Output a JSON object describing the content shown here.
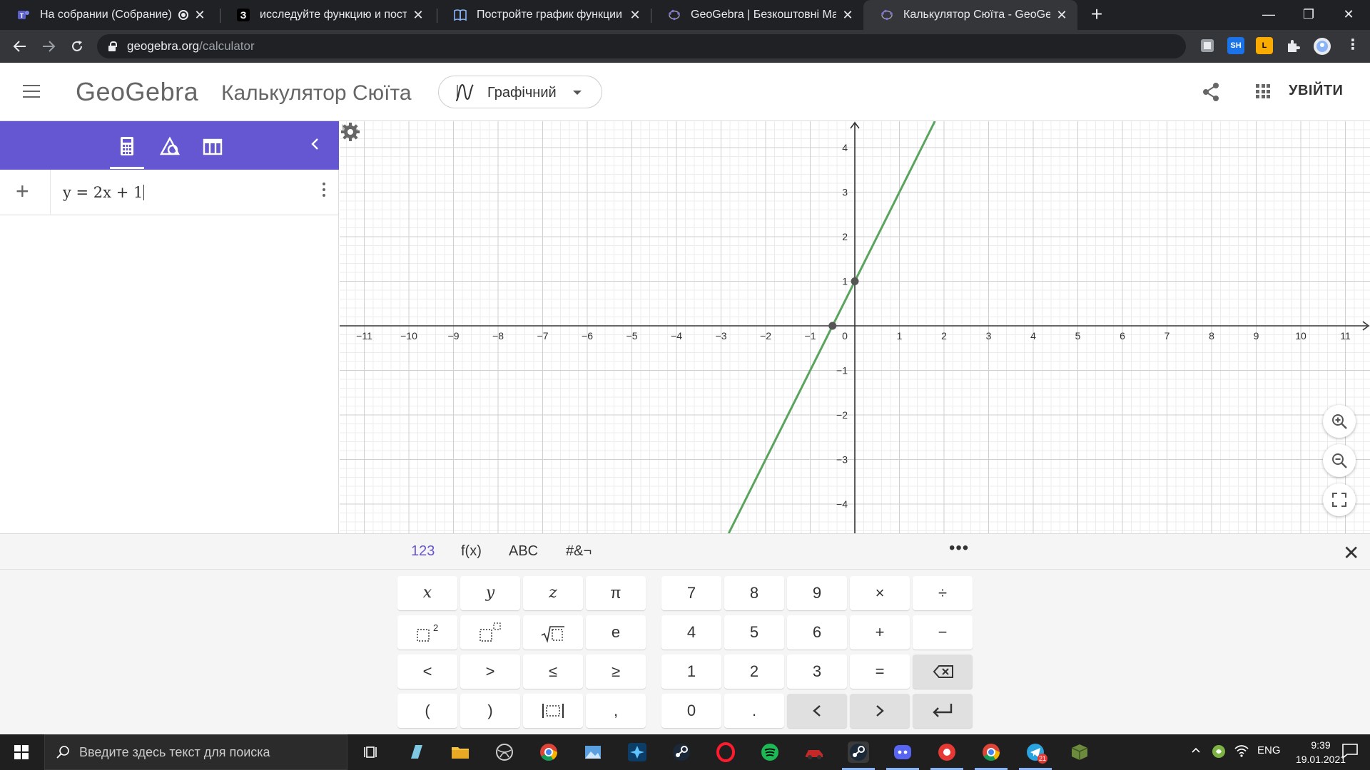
{
  "browser": {
    "tabs": [
      {
        "title": "На собрании (Собрание) | M",
        "icon": "teams-icon"
      },
      {
        "title": "исследуйте функцию и построй",
        "icon": "znanija-icon"
      },
      {
        "title": "Постройте график функции у =",
        "icon": "book-icon"
      },
      {
        "title": "GeoGebra | Безкоштовні Матем",
        "icon": "geogebra-icon"
      },
      {
        "title": "Калькулятор Сюїта - GeoGebra",
        "icon": "geogebra-icon"
      }
    ],
    "new_tab": "+",
    "window_controls": {
      "minimize": "—",
      "restore": "❐",
      "close": "✕"
    },
    "url_host": "geogebra.org",
    "url_path": "/calculator",
    "extensions": [
      {
        "name": "extension-gray",
        "label": "",
        "color": "#9aa0a6"
      },
      {
        "name": "extension-sh",
        "label": "SH",
        "color": "#1a73e8"
      },
      {
        "name": "extension-l",
        "label": "L",
        "color": "#f9ab00"
      }
    ]
  },
  "header": {
    "logo": "GeoGebra",
    "title": "Калькулятор Сюїта",
    "app_switch_label": "Графічний",
    "login": "УВІЙТИ"
  },
  "algebra": {
    "input_expression": "y = 2x + 1"
  },
  "graph": {
    "x_range": [
      -11,
      11
    ],
    "y_range": [
      -4,
      4
    ],
    "x_ticks": [
      "−11",
      "−10",
      "−9",
      "−8",
      "−7",
      "−6",
      "−5",
      "−4",
      "−3",
      "−2",
      "−1",
      "0",
      "1",
      "2",
      "3",
      "4",
      "5",
      "6",
      "7",
      "8",
      "9",
      "10",
      "11"
    ],
    "y_ticks": [
      "−4",
      "−3",
      "−2",
      "−1",
      "1",
      "2",
      "3",
      "4"
    ],
    "line": {
      "slope": 2,
      "intercept": 1,
      "color": "#5aa45f"
    },
    "points": [
      {
        "x": 0,
        "y": 1
      },
      {
        "x": -0.5,
        "y": 0
      }
    ],
    "grid": true,
    "point_color": "#555555"
  },
  "keyboard": {
    "tabs": [
      "123",
      "f(x)",
      "ABC",
      "#&¬"
    ],
    "more": "•••",
    "close": "✕",
    "rows": [
      [
        "x",
        "y",
        "z",
        "π",
        "7",
        "8",
        "9",
        "×",
        "÷"
      ],
      [
        "",
        "",
        "",
        "e",
        "4",
        "5",
        "6",
        "+",
        "−"
      ],
      [
        "<",
        ">",
        "≤",
        "≥",
        "1",
        "2",
        "3",
        "=",
        ""
      ],
      [
        "(",
        ")",
        "",
        ",",
        "0",
        ".",
        "<",
        ">",
        ""
      ]
    ]
  },
  "taskbar": {
    "search_placeholder": "Введите здесь текст для поиска",
    "language": "ENG",
    "time": "9:39",
    "date": "19.01.2021",
    "telegram_badge": "21"
  },
  "colors": {
    "accent": "#6557d2",
    "line": "#5aa45f",
    "chrome_dark": "#202124",
    "chrome_toolbar": "#35363a"
  }
}
